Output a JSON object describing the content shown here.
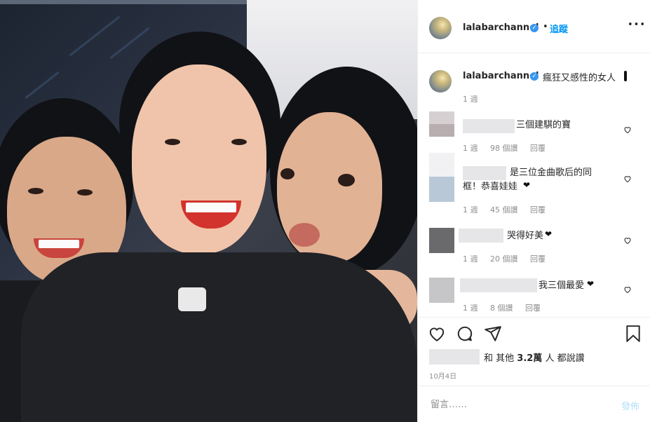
{
  "post": {
    "username": "lalabarchannel",
    "verified_mark": "✓",
    "separator": "•",
    "follow_label": "追蹤",
    "more_label": "•••"
  },
  "caption": {
    "username": "lalabarchannel",
    "text": "瘋狂又感性的女人",
    "time": "1 週"
  },
  "comments": [
    {
      "text": "三個建騏的寶",
      "time": "1 週",
      "likes": "98 個讚",
      "reply": "回覆"
    },
    {
      "text": "是三位金曲歌后的同框！恭喜娃娃",
      "text_line1": "是三位金曲歌后的同",
      "text_line2": "框！恭喜娃娃",
      "time": "1 週",
      "likes": "45 個讚",
      "reply": "回覆"
    },
    {
      "text": "哭得好美",
      "time": "1 週",
      "likes": "20 個讚",
      "reply": "回覆"
    },
    {
      "text": "我三個最愛",
      "time": "1 週",
      "likes": "8 個讚",
      "reply": "回覆"
    }
  ],
  "icons": {
    "like": "heart-icon",
    "comment": "comment-icon",
    "share": "share-icon",
    "save": "bookmark-icon",
    "comment_like": "heart-icon",
    "verified": "verified-badge-icon",
    "more": "more-options-icon"
  },
  "likes_line": {
    "prefix": "和 其他",
    "count": "3.2萬",
    "suffix": "人 都說讚"
  },
  "date": "10月4日",
  "comment_box": {
    "placeholder": "留言……",
    "post_label": "發佈"
  },
  "colors": {
    "accent": "#0095f6",
    "verified": "#3897f0",
    "muted": "#8e8e8e",
    "post_disabled": "#b2dffc"
  }
}
